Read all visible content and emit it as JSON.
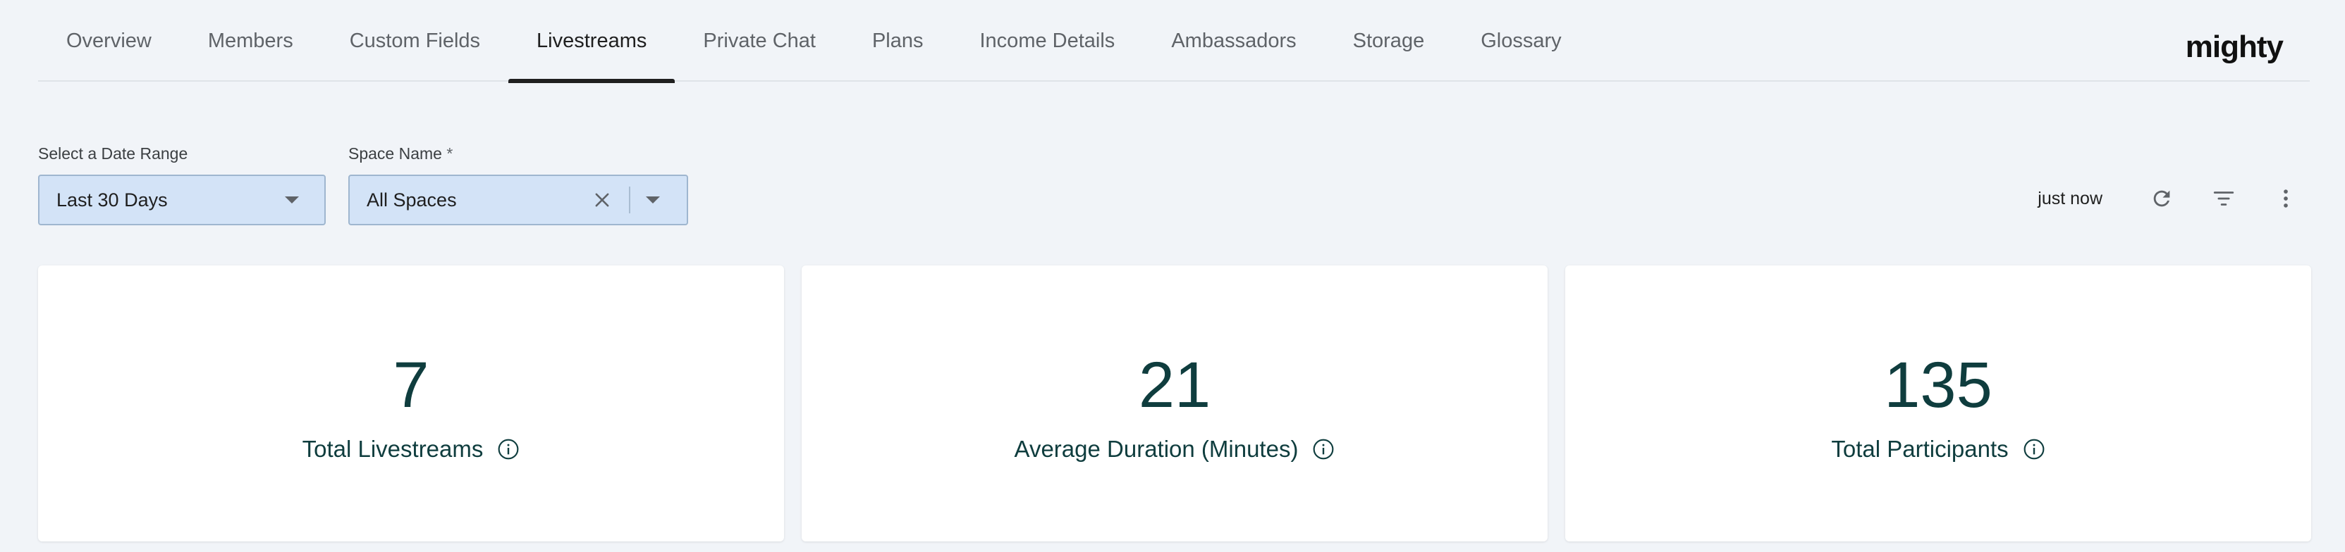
{
  "tabs": [
    {
      "label": "Overview",
      "active": false
    },
    {
      "label": "Members",
      "active": false
    },
    {
      "label": "Custom Fields",
      "active": false
    },
    {
      "label": "Livestreams",
      "active": true
    },
    {
      "label": "Private Chat",
      "active": false
    },
    {
      "label": "Plans",
      "active": false
    },
    {
      "label": "Income Details",
      "active": false
    },
    {
      "label": "Ambassadors",
      "active": false
    },
    {
      "label": "Storage",
      "active": false
    },
    {
      "label": "Glossary",
      "active": false
    }
  ],
  "brand": "mighty",
  "filters": {
    "date_range": {
      "label": "Select a Date Range",
      "value": "Last 30 Days"
    },
    "space_name": {
      "label": "Space Name",
      "required_mark": "*",
      "value": "All Spaces"
    }
  },
  "toolbar": {
    "updated_text": "just now",
    "icons": [
      "refresh-icon",
      "filter-icon",
      "more-vert-icon"
    ]
  },
  "kpis": [
    {
      "value": "7",
      "label": "Total Livestreams"
    },
    {
      "value": "21",
      "label": "Average Duration (Minutes)"
    },
    {
      "value": "135",
      "label": "Total Participants"
    }
  ],
  "colors": {
    "background": "#f1f4f8",
    "select_fill": "#d3e3f7",
    "kpi_text": "#0f3d3e",
    "active_tab_underline": "#1f1f1f"
  }
}
